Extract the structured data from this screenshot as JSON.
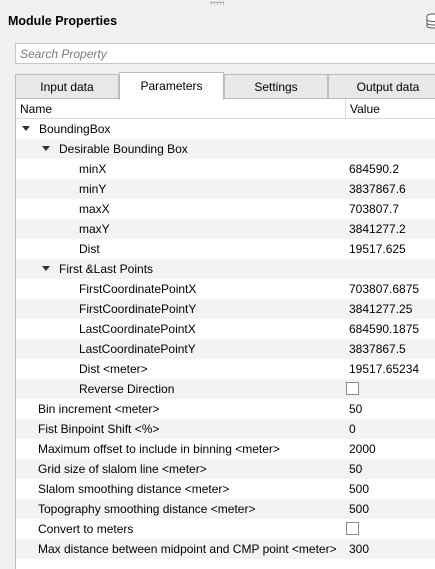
{
  "window": {
    "title": "Module Properties"
  },
  "search": {
    "placeholder": "Search Property"
  },
  "tabs": [
    {
      "label": "Input data"
    },
    {
      "label": "Parameters"
    },
    {
      "label": "Settings"
    },
    {
      "label": "Output data"
    }
  ],
  "table": {
    "headers": {
      "name": "Name",
      "value": "Value"
    },
    "bounding_box": {
      "label": "BoundingBox",
      "desirable": {
        "label": "Desirable Bounding Box",
        "rows": [
          {
            "name": "minX",
            "value": "684590.2"
          },
          {
            "name": "minY",
            "value": "3837867.6"
          },
          {
            "name": "maxX",
            "value": "703807.7"
          },
          {
            "name": "maxY",
            "value": "3841277.2"
          },
          {
            "name": "Dist",
            "value": "19517.625"
          }
        ]
      },
      "first_last": {
        "label": "First &Last Points",
        "rows": [
          {
            "name": "FirstCoordinatePointX",
            "value": "703807.6875"
          },
          {
            "name": "FirstCoordinatePointY",
            "value": "3841277.25"
          },
          {
            "name": "LastCoordinatePointX",
            "value": "684590.1875"
          },
          {
            "name": "LastCoordinatePointY",
            "value": "3837867.5"
          },
          {
            "name": "Dist <meter>",
            "value": "19517.65234"
          }
        ],
        "reverse_direction": {
          "name": "Reverse Direction",
          "checked": false
        }
      }
    },
    "params": [
      {
        "name": "Bin increment <meter>",
        "value": "50"
      },
      {
        "name": "Fist Binpoint Shift <%>",
        "value": "0"
      },
      {
        "name": "Maximum offset to include in binning <meter>",
        "value": "2000"
      },
      {
        "name": "Grid size of slalom line <meter>",
        "value": "50"
      },
      {
        "name": "Slalom smoothing distance <meter>",
        "value": "500"
      },
      {
        "name": "Topography smoothing distance <meter>",
        "value": "500"
      }
    ],
    "convert_to_meters": {
      "name": "Convert to meters",
      "checked": false
    },
    "max_distance": {
      "name": "Max distance between midpoint and CMP point <meter>",
      "value": "300"
    }
  }
}
